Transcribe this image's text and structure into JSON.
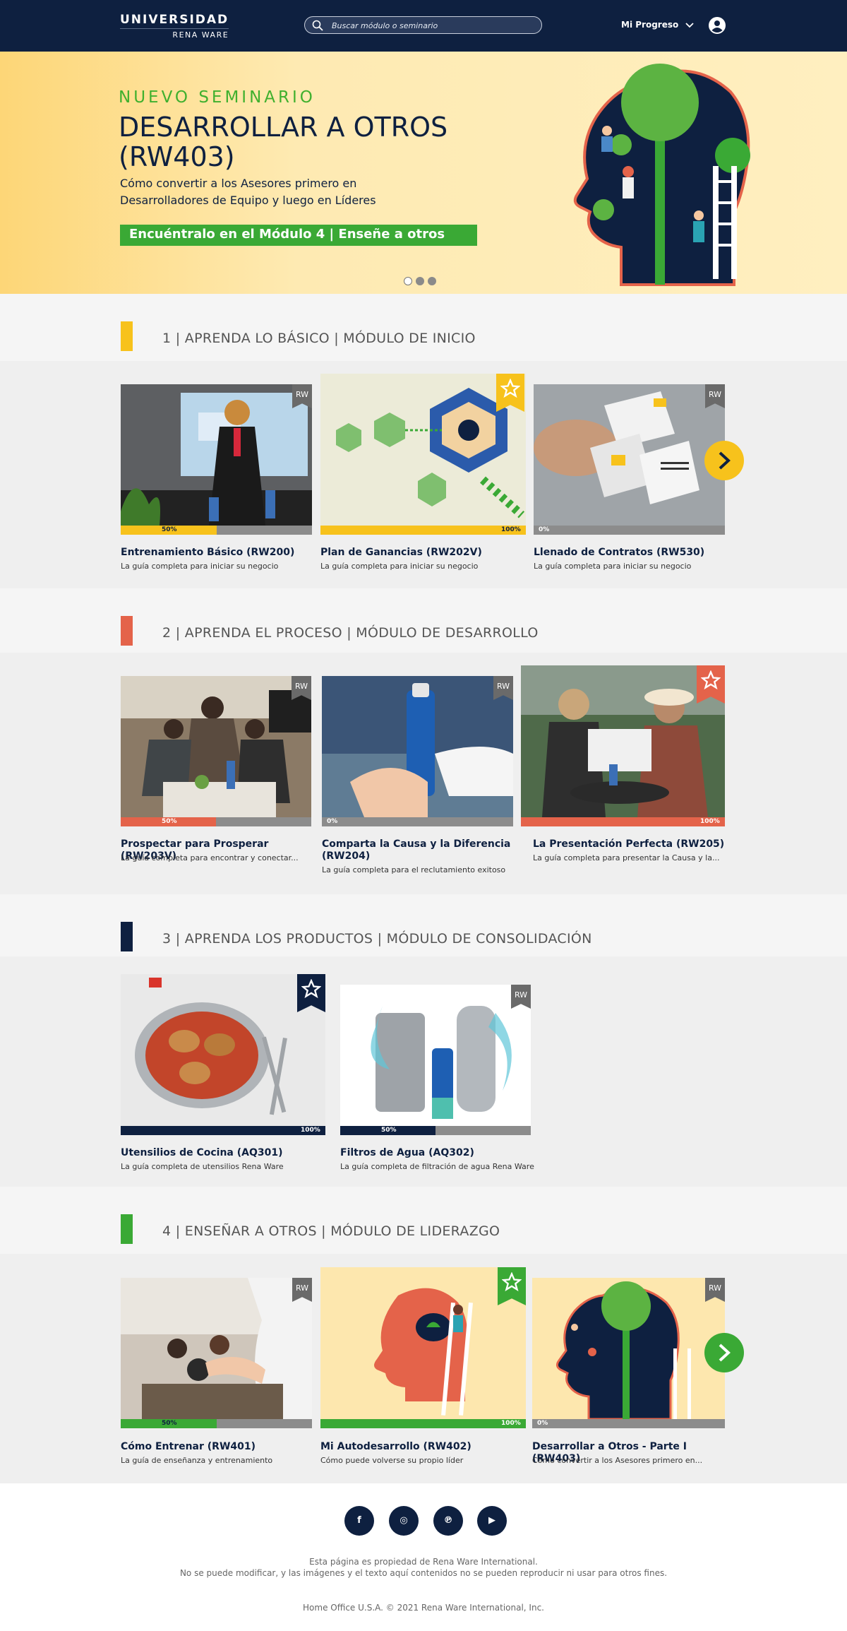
{
  "header": {
    "logo_line1": "UNIVERSIDAD",
    "logo_line2": "RENA WARE",
    "search_placeholder": "Buscar módulo o seminario",
    "progress_label": "Mi Progreso"
  },
  "hero": {
    "tag": "NUEVO SEMINARIO",
    "title": "DESARROLLAR A OTROS (RW403)",
    "description": "Cómo convertir a los Asesores primero en Desarrolladores de Equipo y luego en Líderes",
    "cta": "Encuéntralo en el Módulo 4 | Enseñe a otros",
    "slides": 3,
    "active_slide": 1
  },
  "sections": [
    {
      "heading": "1 | APRENDA LO BÁSICO | MÓDULO DE INICIO",
      "accent": "#f7c21c",
      "cards": [
        {
          "title": "Entrenamiento Básico (RW200)",
          "subtitle": "La guía completa para iniciar su negocio",
          "progress": "50%",
          "badge": "RW",
          "badge_text": "RW",
          "image": "presenter with water bottles"
        },
        {
          "title": "Plan de Ganancias (RW202V)",
          "subtitle": "La guía completa para iniciar su negocio",
          "progress": "100%",
          "badge": "star",
          "image": "team network hexagon graphic"
        },
        {
          "title": "Llenado de Contratos (RW530)",
          "subtitle": "La guía completa para iniciar su negocio",
          "progress": "0%",
          "badge": "RW",
          "badge_text": "RW",
          "image": "hands with contract papers"
        }
      ]
    },
    {
      "heading": "2 | APRENDA EL PROCESO | MÓDULO DE DESARROLLO",
      "accent": "#e4634a",
      "cards": [
        {
          "title": "Prospectar para Prosperar (RW203V)",
          "subtitle": "La guía completa para encontrar y conectar...",
          "progress": "50%",
          "badge": "RW",
          "badge_text": "RW",
          "image": "group of friends at table"
        },
        {
          "title": "Comparta la Causa y la Diferencia (RW204)",
          "subtitle": "La guía completa para el reclutamiento exitoso",
          "progress": "0%",
          "badge": "RW",
          "badge_text": "RW",
          "image": "hands holding water bottle"
        },
        {
          "title": "La Presentación Perfecta (RW205)",
          "subtitle": "La guía completa para presentar la Causa y la...",
          "progress": "100%",
          "badge": "star",
          "image": "two women reading magazine"
        }
      ]
    },
    {
      "heading": "3 | APRENDA LOS PRODUCTOS | MÓDULO DE CONSOLIDACIÓN",
      "accent": "#0e2040",
      "cards": [
        {
          "title": "Utensilios de Cocina (AQ301)",
          "subtitle": "La guía completa de utensilios Rena Ware",
          "progress": "100%",
          "badge": "star",
          "image": "pan with chicken"
        },
        {
          "title": "Filtros de Agua (AQ302)",
          "subtitle": "La guía completa de filtración de agua Rena Ware",
          "progress": "50%",
          "badge": "RW",
          "badge_text": "RW",
          "image": "water filters"
        }
      ]
    },
    {
      "heading": "4 | ENSEÑAR A OTROS | MÓDULO DE LIDERAZGO",
      "accent": "#3aa935",
      "cards": [
        {
          "title": "Cómo Entrenar (RW401)",
          "subtitle": "La guía de enseñanza y entrenamiento",
          "progress": "50%",
          "badge": "RW",
          "badge_text": "RW",
          "image": "presenter in meeting"
        },
        {
          "title": "Mi Autodesarrollo (RW402)",
          "subtitle": "Cómo puede volverse su propio líder",
          "progress": "100%",
          "badge": "star",
          "image": "head with ladder illustration"
        },
        {
          "title": "Desarrollar a Otros - Parte I (RW403)",
          "subtitle": "Cómo convertir a los Asesores primero en...",
          "progress": "0%",
          "badge": "RW",
          "badge_text": "RW",
          "image": "head with tree illustration"
        }
      ]
    }
  ],
  "footer": {
    "social": [
      {
        "name": "facebook",
        "glyph": "f"
      },
      {
        "name": "instagram",
        "glyph": "◎"
      },
      {
        "name": "pinterest",
        "glyph": "℗"
      },
      {
        "name": "youtube",
        "glyph": "▶"
      }
    ],
    "notice_line1": "Esta página es propiedad de Rena Ware International.",
    "notice_line2": "No se puede modificar, y las imágenes y el texto aquí contenidos no se pueden reproducir ni usar para otros fines.",
    "copyright": "Home Office U.S.A. © 2021 Rena Ware International, Inc."
  }
}
